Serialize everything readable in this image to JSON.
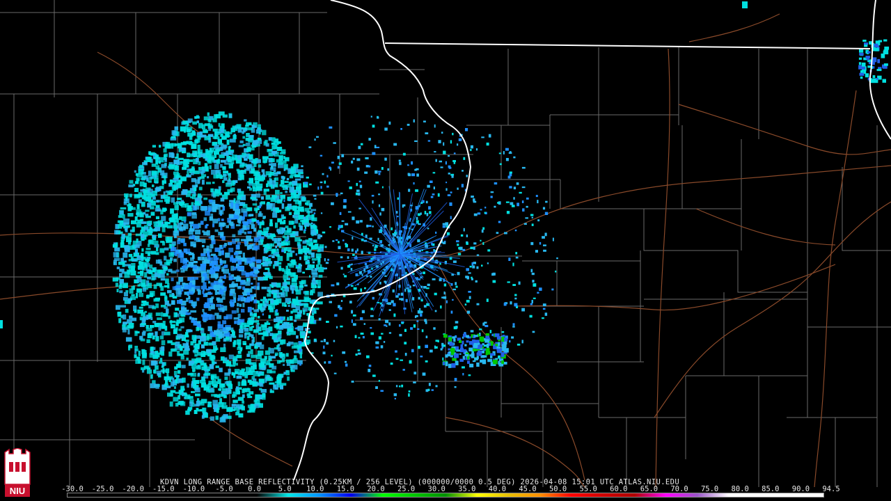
{
  "product": {
    "station": "KDVN",
    "caption": "KDVN LONG RANGE BASE REFLECTIVITY (0.25KM / 256 LEVEL) (000000/0000 0.5 DEG) 2026-04-08 15:01 UTC  ATLAS.NIU.EDU"
  },
  "logo": {
    "text": "NIU",
    "icon": "castle-tower-icon",
    "color": "#c8102e"
  },
  "scale": {
    "labels": [
      "-30.0",
      "-25.0",
      "-20.0",
      "-15.0",
      "-10.0",
      "-5.0",
      "0.0",
      "5.0",
      "10.0",
      "15.0",
      "20.0",
      "25.0",
      "30.0",
      "35.0",
      "40.0",
      "45.0",
      "50.0",
      "55.0",
      "60.0",
      "65.0",
      "70.0",
      "75.0",
      "80.0",
      "85.0",
      "90.0",
      "94.5"
    ],
    "colors": [
      "#000000",
      "#000000",
      "#000000",
      "#000000",
      "#000000",
      "#000000",
      "#000000",
      "#00e8e8",
      "#0094ff",
      "#0000f0",
      "#00ff00",
      "#00c800",
      "#009000",
      "#ffff00",
      "#e8c000",
      "#ff9000",
      "#ff0000",
      "#d00000",
      "#b00000",
      "#ff00ff",
      "#9a55c9",
      "#ffffff",
      "#ffffff",
      "#ffffff",
      "#ffffff"
    ]
  },
  "map": {
    "background": "#000000",
    "county_color": "#6e6e6e",
    "state_color": "#ffffff",
    "highway_color": "#8a4a2a",
    "echo_colors": [
      "#00e0e0",
      "#28b8f0",
      "#1e90ff",
      "#2060e8",
      "#00c800"
    ]
  }
}
